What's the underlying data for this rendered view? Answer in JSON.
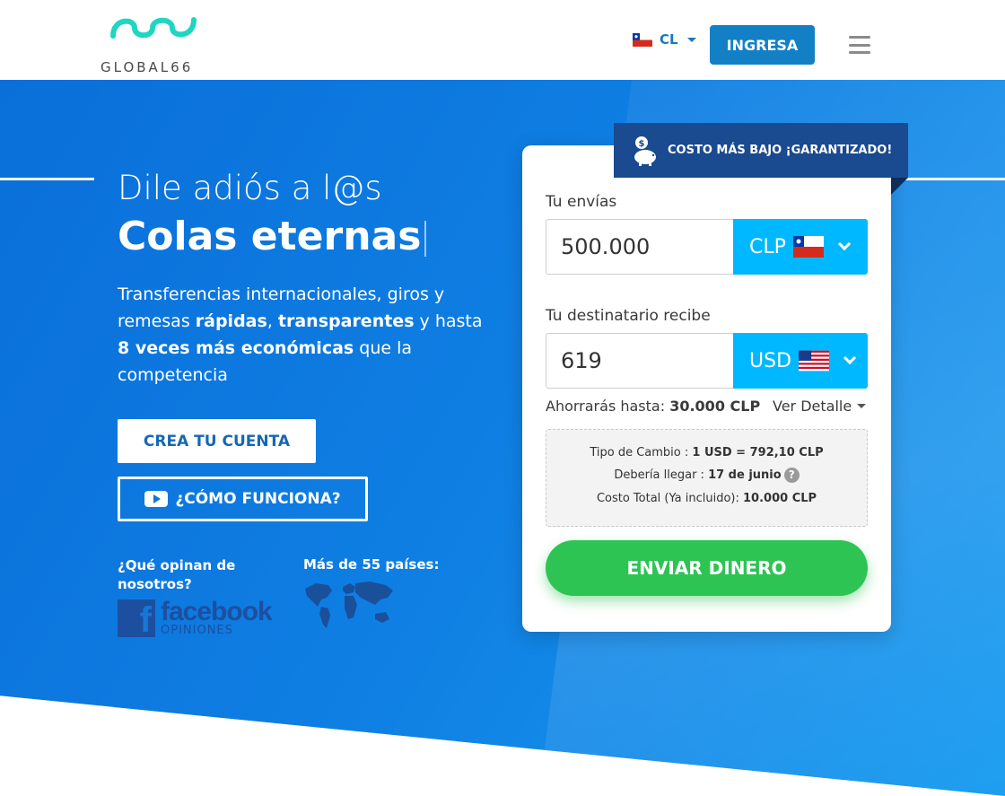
{
  "header": {
    "brand": "GLOBAL66",
    "country_code": "CL",
    "login_label": "INGRESA"
  },
  "hero": {
    "headline_line1": "Dile adiós a l@s",
    "headline_line2": "Colas eternas",
    "desc": {
      "p1": "Transferencias internacionales, giros y remesas ",
      "b1": "rápidas",
      "p2": ", ",
      "b2": "transparentes",
      "p3": " y hasta ",
      "b3": "8 veces más económicas",
      "p4": " que la competencia"
    },
    "create_account_label": "CREA TU CUENTA",
    "how_it_works_label": "¿CÓMO FUNCIONA?",
    "opinion_title": "¿Qué opinan de nosotros?",
    "facebook_big": "facebook",
    "facebook_small": "OPINIONES",
    "facebook_f": "f",
    "countries_title": "Más de 55 países:"
  },
  "calculator": {
    "badge_text_normal": "COSTO MÁS BAJO ",
    "badge_text_bold": "¡GARANTIZADO!",
    "send_label": "Tu envías",
    "send_amount": "500.000",
    "send_currency": "CLP",
    "receive_label": "Tu destinatario recibe",
    "receive_amount": "619",
    "receive_currency": "USD",
    "savings_prefix": "Ahorrarás hasta: ",
    "savings_value": "30.000 CLP",
    "details_label": "Ver Detalle",
    "exchange_prefix": "Tipo de Cambio : ",
    "exchange_value": "1 USD = 792,10 CLP",
    "arrival_prefix": "Debería llegar : ",
    "arrival_value": "17 de junio",
    "help_glyph": "?",
    "total_prefix": "Costo Total (Ya incluido): ",
    "total_value": "10.000 CLP",
    "send_button_label": "ENVIAR DINERO"
  },
  "colors": {
    "brand_teal": "#1ed6c1",
    "primary_blue": "#1380c6",
    "currency_cyan": "#00b8ff",
    "cta_green": "#2ec454",
    "badge_navy": "#1a4a8f"
  }
}
